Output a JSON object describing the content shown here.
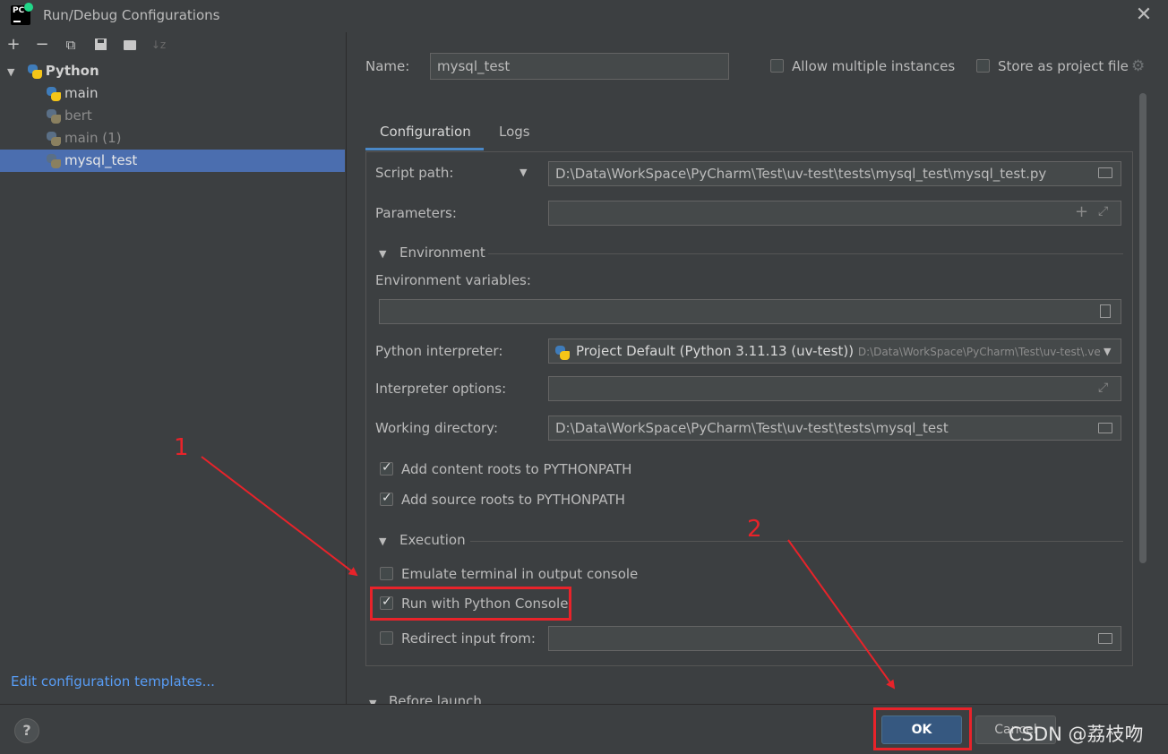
{
  "window": {
    "title": "Run/Debug Configurations",
    "app_icon_text": "PC"
  },
  "toolbar": {
    "add": "+",
    "remove": "−",
    "copy": "⧉",
    "save": "💾",
    "folder": "📁",
    "sort": "↓z"
  },
  "tree": {
    "group_label": "Python",
    "items": [
      {
        "label": "main",
        "dim": false
      },
      {
        "label": "bert",
        "dim": true
      },
      {
        "label": "main (1)",
        "dim": true
      },
      {
        "label": "mysql_test",
        "dim": true,
        "selected": true
      }
    ]
  },
  "edit_templates_link": "Edit configuration templates...",
  "name_row": {
    "label": "Name:",
    "value": "mysql_test",
    "allow_multiple_label": "Allow multiple instances",
    "allow_multiple_checked": false,
    "store_project_label": "Store as project file",
    "store_project_checked": false
  },
  "tabs": [
    {
      "label": "Configuration",
      "active": true
    },
    {
      "label": "Logs",
      "active": false
    }
  ],
  "config": {
    "script_path_label": "Script path:",
    "script_path_value": "D:\\Data\\WorkSpace\\PyCharm\\Test\\uv-test\\tests\\mysql_test\\mysql_test.py",
    "parameters_label": "Parameters:",
    "parameters_value": "",
    "environment_section": "Environment",
    "env_vars_label": "Environment variables:",
    "env_vars_value": "",
    "interpreter_label": "Python interpreter:",
    "interpreter_value": "Project Default (Python 3.11.13 (uv-test))",
    "interpreter_path": "D:\\Data\\WorkSpace\\PyCharm\\Test\\uv-test\\.ve",
    "interp_options_label": "Interpreter options:",
    "interp_options_value": "",
    "working_dir_label": "Working directory:",
    "working_dir_value": "D:\\Data\\WorkSpace\\PyCharm\\Test\\uv-test\\tests\\mysql_test",
    "content_roots_label": "Add content roots to PYTHONPATH",
    "content_roots_checked": true,
    "source_roots_label": "Add source roots to PYTHONPATH",
    "source_roots_checked": true,
    "execution_section": "Execution",
    "emulate_terminal_label": "Emulate terminal in output console",
    "emulate_terminal_checked": false,
    "run_console_label": "Run with Python Console",
    "run_console_checked": true,
    "redirect_input_label": "Redirect input from:",
    "redirect_input_checked": false,
    "redirect_input_value": "",
    "before_launch_section": "Before launch"
  },
  "buttons": {
    "help": "?",
    "ok": "OK",
    "cancel": "Cancel"
  },
  "annotations": {
    "one": "1",
    "two": "2",
    "color": "#e8232a"
  },
  "watermark": "CSDN @荔枝吻"
}
